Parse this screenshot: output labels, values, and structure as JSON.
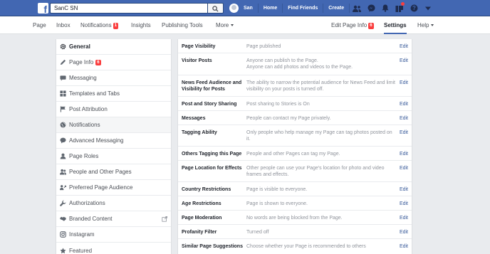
{
  "topbar": {
    "logo_letter": "f",
    "search_value": "SanC SN",
    "user_name": "San",
    "links": [
      "Home",
      "Find Friends",
      "Create"
    ]
  },
  "pagenav": {
    "left": [
      "Page",
      "Inbox",
      "Notifications",
      "Insights",
      "Publishing Tools",
      "More"
    ],
    "notifications_badge": "1",
    "edit_page_info": "Edit Page Info",
    "edit_page_info_badge": "6",
    "settings": "Settings",
    "help": "Help"
  },
  "sidebar": {
    "items": [
      {
        "label": "General",
        "icon": "gear-icon"
      },
      {
        "label": "Page Info",
        "icon": "pencil-icon",
        "badge": "6"
      },
      {
        "label": "Messaging",
        "icon": "messaging-icon"
      },
      {
        "label": "Templates and Tabs",
        "icon": "grid-icon"
      },
      {
        "label": "Post Attribution",
        "icon": "flag-icon"
      },
      {
        "label": "Notifications",
        "icon": "globe-icon"
      },
      {
        "label": "Advanced Messaging",
        "icon": "chat-icon"
      },
      {
        "label": "Page Roles",
        "icon": "person-icon"
      },
      {
        "label": "People and Other Pages",
        "icon": "people-icon"
      },
      {
        "label": "Preferred Page Audience",
        "icon": "audience-icon"
      },
      {
        "label": "Authorizations",
        "icon": "wrench-icon"
      },
      {
        "label": "Branded Content",
        "icon": "handshake-icon"
      },
      {
        "label": "Instagram",
        "icon": "instagram-icon"
      },
      {
        "label": "Featured",
        "icon": "star-icon"
      }
    ]
  },
  "settings": {
    "edit_label": "Edit",
    "rows": [
      {
        "label": "Page Visibility",
        "value": "Page published"
      },
      {
        "label": "Visitor Posts",
        "value": "Anyone can publish to the Page.\nAnyone can add photos and videos to the Page."
      },
      {
        "label": "News Feed Audience and Visibility for Posts",
        "value": "The ability to narrow the potential audience for News Feed and limit visibility on your posts is turned off."
      },
      {
        "label": "Post and Story Sharing",
        "value": "Post sharing to Stories is On"
      },
      {
        "label": "Messages",
        "value": "People can contact my Page privately."
      },
      {
        "label": "Tagging Ability",
        "value": "Only people who help manage my Page can tag photos posted on it."
      },
      {
        "label": "Others Tagging this Page",
        "value": "People and other Pages can tag my Page."
      },
      {
        "label": "Page Location for Effects",
        "value": "Other people can use your Page's location for photo and video frames and effects."
      },
      {
        "label": "Country Restrictions",
        "value": "Page is visible to everyone."
      },
      {
        "label": "Age Restrictions",
        "value": "Page is shown to everyone."
      },
      {
        "label": "Page Moderation",
        "value": "No words are being blocked from the Page."
      },
      {
        "label": "Profanity Filter",
        "value": "Turned off"
      },
      {
        "label": "Similar Page Suggestions",
        "value": "Choose whether your Page is recommended to others"
      }
    ]
  }
}
